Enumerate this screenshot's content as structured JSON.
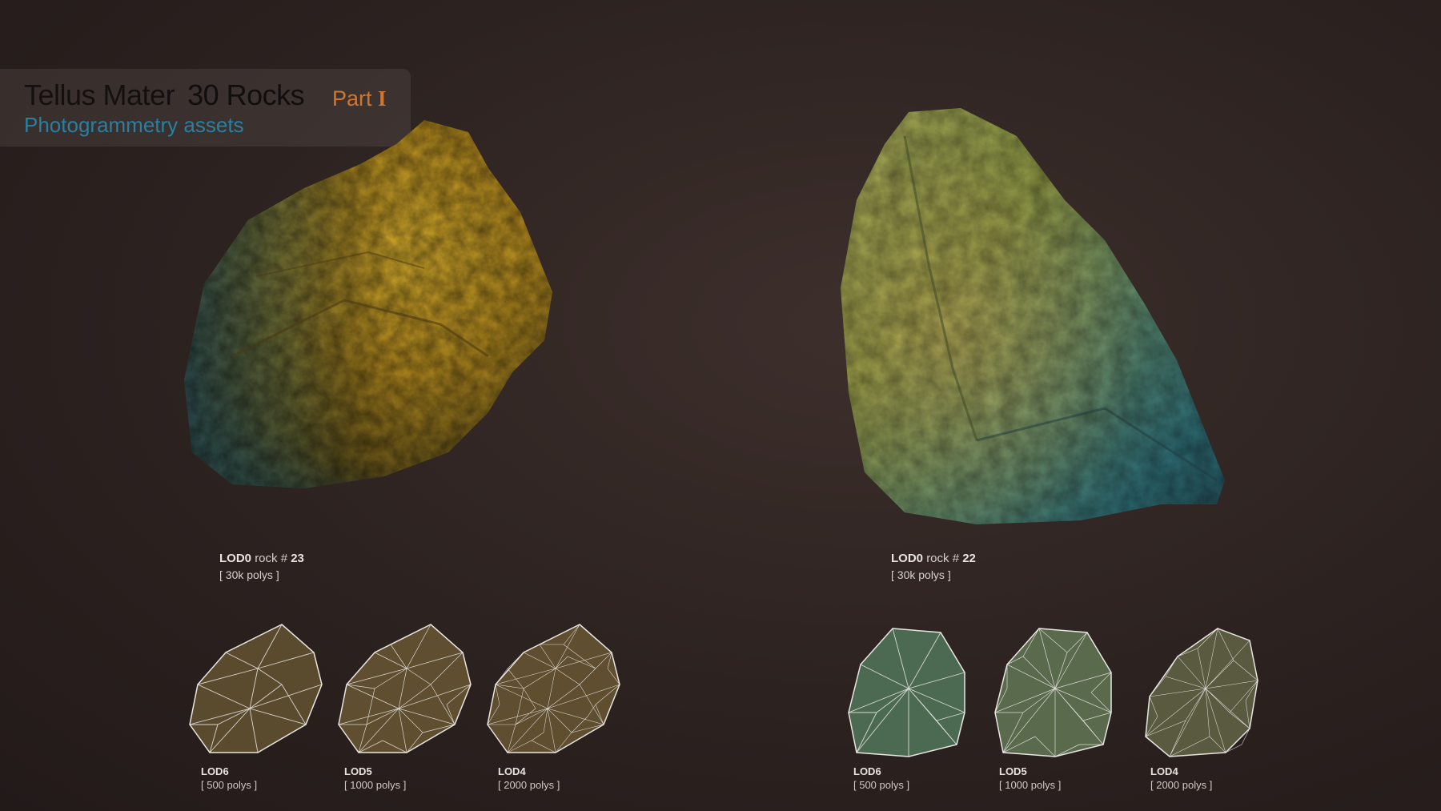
{
  "header": {
    "title": "Tellus Mater",
    "count": "30 Rocks",
    "part_word": "Part",
    "part_numeral": "I",
    "subtitle": "Photogrammetry assets",
    "colors": {
      "part": "#d3762c",
      "subtitle": "#2b7fa0"
    }
  },
  "left_rock": {
    "lod_label": "LOD0",
    "rock_text": "rock #",
    "rock_number": "23",
    "polys": "[ 30k polys ]",
    "lods": [
      {
        "label": "LOD6",
        "polys": "[ 500 polys ]"
      },
      {
        "label": "LOD5",
        "polys": "[ 1000 polys ]"
      },
      {
        "label": "LOD4",
        "polys": "[ 2000 polys ]"
      }
    ]
  },
  "right_rock": {
    "lod_label": "LOD0",
    "rock_text": "rock #",
    "rock_number": "22",
    "polys": "[ 30k polys ]",
    "lods": [
      {
        "label": "LOD6",
        "polys": "[ 500 polys ]"
      },
      {
        "label": "LOD5",
        "polys": "[ 1000 polys ]"
      },
      {
        "label": "LOD4",
        "polys": "[ 2000 polys ]"
      }
    ]
  }
}
